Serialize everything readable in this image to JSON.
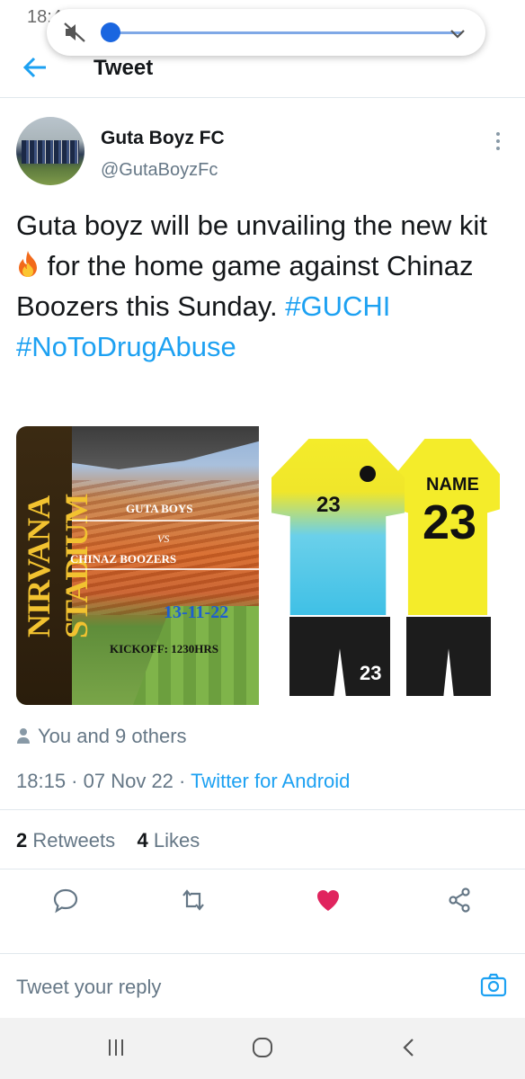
{
  "status_bar": {
    "time": "18:49"
  },
  "header": {
    "title": "Tweet"
  },
  "tweet": {
    "author_name": "Guta Boyz FC",
    "author_handle": "@GutaBoyzFc",
    "text_part1": "Guta boyz will be unvailing the new kit",
    "text_part2": " for the home game against Chinaz Boozers this Sunday. ",
    "hashtag1": "#GUCHI",
    "hashtag2": "#NoToDrugAbuse",
    "poster": {
      "venue": "NIRVANA STADIUM",
      "team1": "GUTA BOYS",
      "vs": "VS",
      "team2": "CHINAZ BOOZERS",
      "date": "13-11-22",
      "kickoff": "KICKOFF: 1230HRS"
    },
    "kit": {
      "front_number": "23",
      "back_name": "NAME",
      "back_number": "23",
      "shorts_number": "23"
    },
    "likers": "You and 9 others",
    "time": "18:15",
    "date": "07 Nov 22",
    "source": "Twitter for Android",
    "retweets_count": "2",
    "retweets_label": "Retweets",
    "likes_count": "4",
    "likes_label": "Likes"
  },
  "reply": {
    "placeholder": "Tweet your reply"
  },
  "colors": {
    "accent": "#1da1f2",
    "like": "#e0245e",
    "muted": "#657786"
  }
}
